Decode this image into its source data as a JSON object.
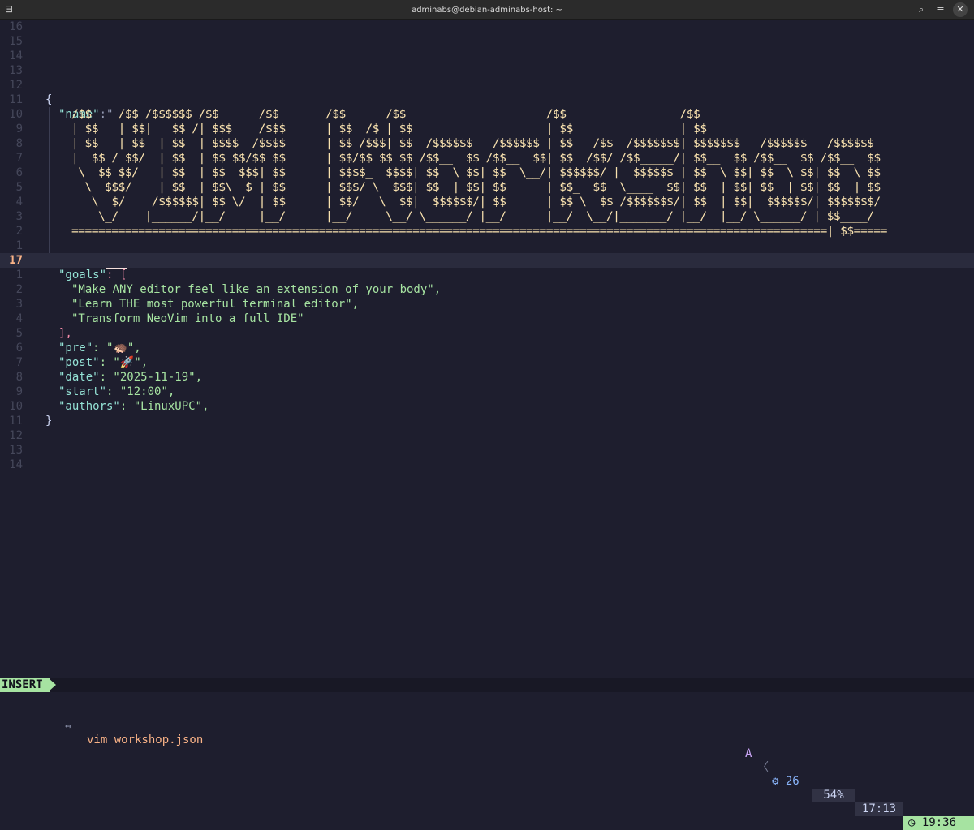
{
  "window": {
    "title": "adminabs@debian-adminabs-host: ~"
  },
  "icons": {
    "app": "terminal-icon",
    "search": "search-icon",
    "menu": "hamburger-menu-icon",
    "close": "close-icon"
  },
  "colors": {
    "background": "#1e1e2e",
    "mode": "#a6e3a1",
    "filename": "#fab387",
    "ascii": "#f9e2af"
  },
  "editor": {
    "line_numbers": [
      "16",
      "15",
      "14",
      "13",
      "12",
      "11",
      "10",
      "9",
      "8",
      "7",
      "6",
      "5",
      "4",
      "3",
      "2",
      "1",
      "17",
      "1",
      "2",
      "3",
      "4",
      "5",
      "6",
      "7",
      "8",
      "9",
      "10",
      "11",
      "12",
      "13",
      "14"
    ],
    "lines": {
      "open_brace": "{",
      "name_key": "\"name\"",
      "name_colon": ":\"",
      "name_close": "\",",
      "goals_key": "\"goals\"",
      "goals_open": ": [",
      "goal_1": "\"Make ANY editor feel like an extension of your body\",",
      "goal_2": "\"Learn THE most powerful terminal editor\",",
      "goal_3": "\"Transform NeoVim into a full IDE\"",
      "goals_close": "],",
      "pre_key": "\"pre\"",
      "pre_value": ": \"🦔\",",
      "post_key": "\"post\"",
      "post_value": ": \"🚀\",",
      "date_key": "\"date\"",
      "date_value": ": \"2025-11-19\",",
      "start_key": "\"start\"",
      "start_value": ": \"12:00\",",
      "authors_key": "\"authors\"",
      "authors_value": ": \"LinuxUPC\",",
      "close_brace": "}"
    },
    "ascii_art": "/$$    /$$ /$$$$$$ /$$      /$$       /$$      /$$                     /$$                 /$$\n| $$   | $$|_  $$_/| $$$    /$$$      | $$  /$ | $$                    | $$                | $$\n| $$   | $$  | $$  | $$$$  /$$$$      | $$ /$$$| $$  /$$$$$$   /$$$$$$ | $$   /$$  /$$$$$$$| $$$$$$$   /$$$$$$   /$$$$$$\n|  $$ / $$/  | $$  | $$ $$/$$ $$      | $$/$$ $$ $$ /$$__  $$ /$$__  $$| $$  /$$/ /$$_____/| $$__  $$ /$$__  $$ /$$__  $$\n \\  $$ $$/   | $$  | $$  $$$| $$      | $$$$_  $$$$| $$  \\ $$| $$  \\__/| $$$$$$/ |  $$$$$$ | $$  \\ $$| $$  \\ $$| $$  \\ $$\n  \\  $$$/    | $$  | $$\\  $ | $$      | $$$/ \\  $$$| $$  | $$| $$      | $$_  $$  \\____  $$| $$  | $$| $$  | $$| $$  | $$\n   \\  $/    /$$$$$$| $$ \\/  | $$      | $$/   \\  $$|  $$$$$$/| $$      | $$ \\  $$ /$$$$$$$/| $$  | $$|  $$$$$$/| $$$$$$$/\n    \\_/    |______/|__/     |__/      |__/     \\__/ \\______/ |__/      |__/  \\__/|_______/ |__/  |__/ \\______/ | $$____/\n=================================================================================================================| $$=====",
    "current_line": "17"
  },
  "statusline": {
    "mode": "INSERT",
    "file_icon": "↔",
    "filename": "vim_workshop.json",
    "indicator": "A",
    "chevron": "〈",
    "lsp_icon": "⚙",
    "lsp_count": "26",
    "percent": "54%",
    "position": "17:13",
    "clock_icon": "◷",
    "clock": "19:36"
  }
}
